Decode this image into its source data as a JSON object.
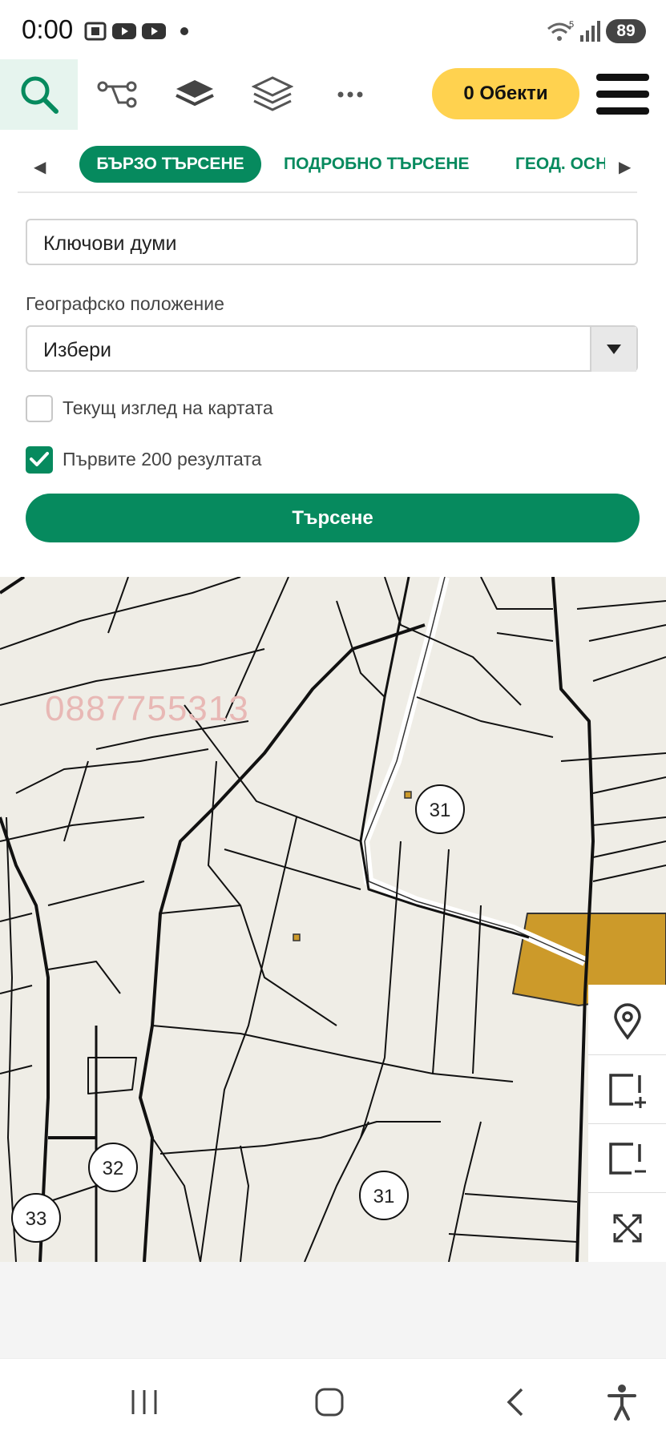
{
  "status_bar": {
    "time": "0:00",
    "battery": "89",
    "icons": [
      "screenshot-icon",
      "youtube-icon",
      "youtube-icon",
      "notification-dot-icon",
      "wifi-icon",
      "signal-icon",
      "battery-icon"
    ]
  },
  "toolbar": {
    "objects_label": "0 Обекти",
    "icons": [
      "search-icon",
      "route-icon",
      "layer-stack-icon",
      "layers-outline-icon",
      "more-icon",
      "menu-icon"
    ]
  },
  "tabs": {
    "items": [
      "БЪРЗО ТЪРСЕНЕ",
      "ПОДРОБНО ТЪРСЕНЕ",
      "ГЕОД. ОСН"
    ],
    "active": "БЪРЗО ТЪРСЕНЕ"
  },
  "form": {
    "keywords_placeholder": "Ключови думи",
    "location_label": "Географско положение",
    "location_value": "Избери",
    "current_view_label": "Текущ изглед на картата",
    "current_view_checked": false,
    "first_results_label": "Първите 200 резултата",
    "first_results_checked": true,
    "search_button": "Търсене"
  },
  "map": {
    "watermark": "0887755313",
    "markers": [
      "31",
      "31",
      "32",
      "33"
    ],
    "highlight_color": "#cc9a2a"
  },
  "colors": {
    "primary": "#068a5e",
    "accent": "#ffd24f"
  }
}
